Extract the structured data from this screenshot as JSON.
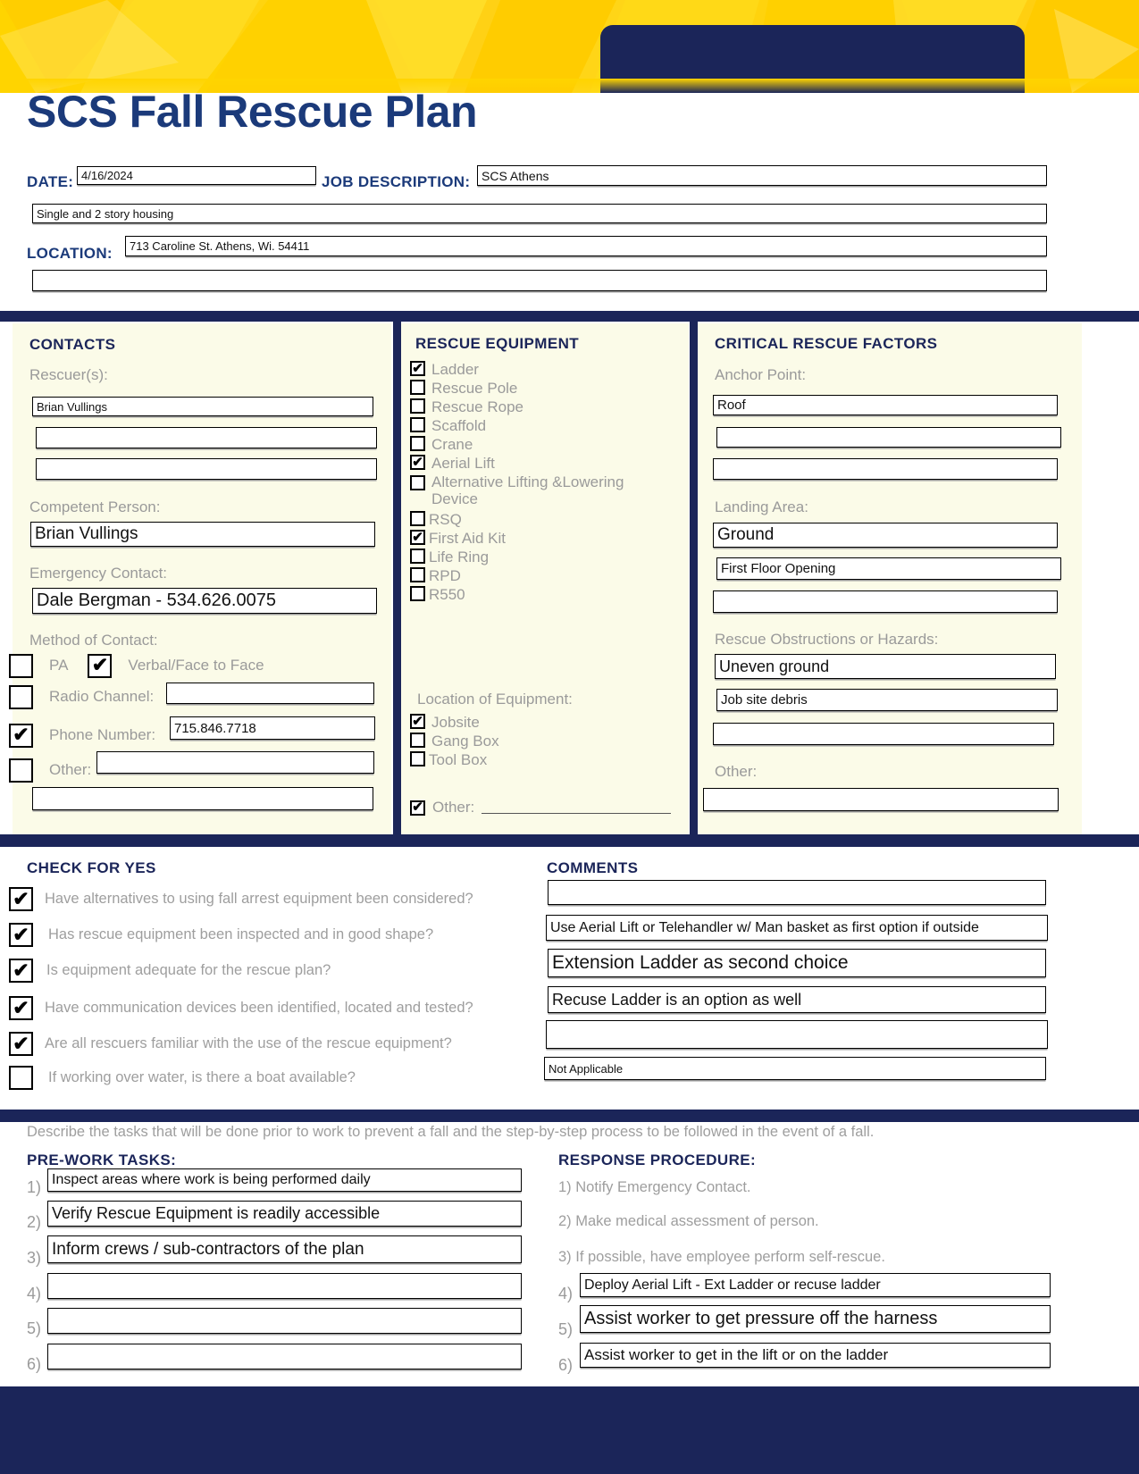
{
  "header": {
    "title": "SCS Fall Rescue Plan",
    "accent_yellow": "#FFD400",
    "accent_navy": "#1B2559",
    "title_color": "#1B3A7A"
  },
  "top_fields": {
    "date_label": "DATE:",
    "date_value": "4/16/2024",
    "job_description_label": "JOB DESCRIPTION:",
    "job_description_value": "SCS Athens",
    "job_description_line2": "Single and 2 story housing",
    "location_label": "LOCATION:",
    "location_value": "713 Caroline St. Athens, Wi. 54411",
    "location_line2": ""
  },
  "contacts": {
    "heading": "CONTACTS",
    "rescuers_label": "Rescuer(s):",
    "rescuers": [
      "Brian Vullings",
      "",
      ""
    ],
    "competent_person_label": "Competent Person:",
    "competent_person": "Brian Vullings",
    "emergency_contact_label": "Emergency Contact:",
    "emergency_contact": "Dale Bergman - 534.626.0075",
    "method_label": "Method of Contact:",
    "pa_label": "PA",
    "pa_checked": false,
    "verbal_label": "Verbal/Face to Face",
    "verbal_checked": true,
    "radio_label": "Radio Channel:",
    "radio_checked": false,
    "radio_value": "",
    "phone_label": "Phone Number:",
    "phone_checked": true,
    "phone_value": "715.846.7718",
    "other_label": "Other:",
    "other_checked": false,
    "other_value": "",
    "extra_value": ""
  },
  "rescue_equipment": {
    "heading": "RESCUE EQUIPMENT",
    "items": [
      {
        "label": "Ladder",
        "checked": true
      },
      {
        "label": "Rescue Pole",
        "checked": false
      },
      {
        "label": "Rescue Rope",
        "checked": false
      },
      {
        "label": "Scaffold",
        "checked": false
      },
      {
        "label": "Crane",
        "checked": false
      },
      {
        "label": "Aerial Lift",
        "checked": true
      },
      {
        "label": "Alternative Lifting &Lowering Device",
        "checked": false
      },
      {
        "label": "RSQ",
        "checked": false
      },
      {
        "label": "First Aid Kit",
        "checked": true
      },
      {
        "label": "Life Ring",
        "checked": false
      },
      {
        "label": "RPD",
        "checked": false
      },
      {
        "label": "R550",
        "checked": false
      }
    ],
    "location_heading": "Location of Equipment:",
    "locations": [
      {
        "label": "Jobsite",
        "checked": true
      },
      {
        "label": "Gang Box",
        "checked": false
      },
      {
        "label": "Tool Box",
        "checked": false
      }
    ],
    "other_label": "Other:",
    "other_checked": true,
    "other_value": ""
  },
  "critical_factors": {
    "heading": "CRITICAL RESCUE FACTORS",
    "anchor_point_label": "Anchor Point:",
    "anchor_points": [
      "Roof",
      "",
      ""
    ],
    "landing_area_label": "Landing Area:",
    "landing_areas": [
      "Ground",
      "First Floor Opening",
      ""
    ],
    "hazards_label": "Rescue Obstructions or Hazards:",
    "hazards": [
      "Uneven ground",
      "Job site debris",
      ""
    ],
    "other_label": "Other:",
    "other_value": ""
  },
  "check_for_yes": {
    "heading": "CHECK FOR YES",
    "items": [
      {
        "question": "Have alternatives to using fall arrest equipment been considered?",
        "checked": true
      },
      {
        "question": "Has rescue equipment been inspected and in good shape?",
        "checked": true
      },
      {
        "question": "Is equipment adequate for the rescue plan?",
        "checked": true
      },
      {
        "question": "Have communication devices been identified, located and tested?",
        "checked": true
      },
      {
        "question": "Are all rescuers familiar with the use of the rescue equipment?",
        "checked": true
      },
      {
        "question": "If working over water, is there a boat available?",
        "checked": false
      }
    ]
  },
  "comments": {
    "heading": "COMMENTS",
    "lines": [
      "",
      "Use Aerial Lift or Telehandler w/ Man basket as first option if outside",
      "Extension Ladder as second choice",
      "Recuse Ladder is an option as well",
      "",
      "Not Applicable"
    ]
  },
  "bottom": {
    "describe_note": "Describe the tasks that will be done prior to work to prevent a fall and the step-by-step process to be followed in the event of a fall.",
    "pre_work_heading": "PRE-WORK TASKS:",
    "pre_work_numbers": [
      "1)",
      "2)",
      "3)",
      "4)",
      "5)",
      "6)"
    ],
    "pre_work_tasks": [
      "Inspect areas where work is being performed daily",
      "Verify Rescue Equipment is readily accessible",
      "Inform crews / sub-contractors of the plan",
      "",
      "",
      ""
    ],
    "response_heading": "RESPONSE PROCEDURE:",
    "response_static": [
      "1) Notify Emergency Contact.",
      "2) Make medical assessment of person.",
      "3) If possible, have employee perform self-rescue."
    ],
    "response_numbers": [
      "4)",
      "5)",
      "6)"
    ],
    "response_fields": [
      "Deploy Aerial Lift - Ext Ladder or recuse ladder",
      "Assist worker to get pressure off the harness",
      "Assist worker to get in the lift or on the ladder"
    ]
  }
}
